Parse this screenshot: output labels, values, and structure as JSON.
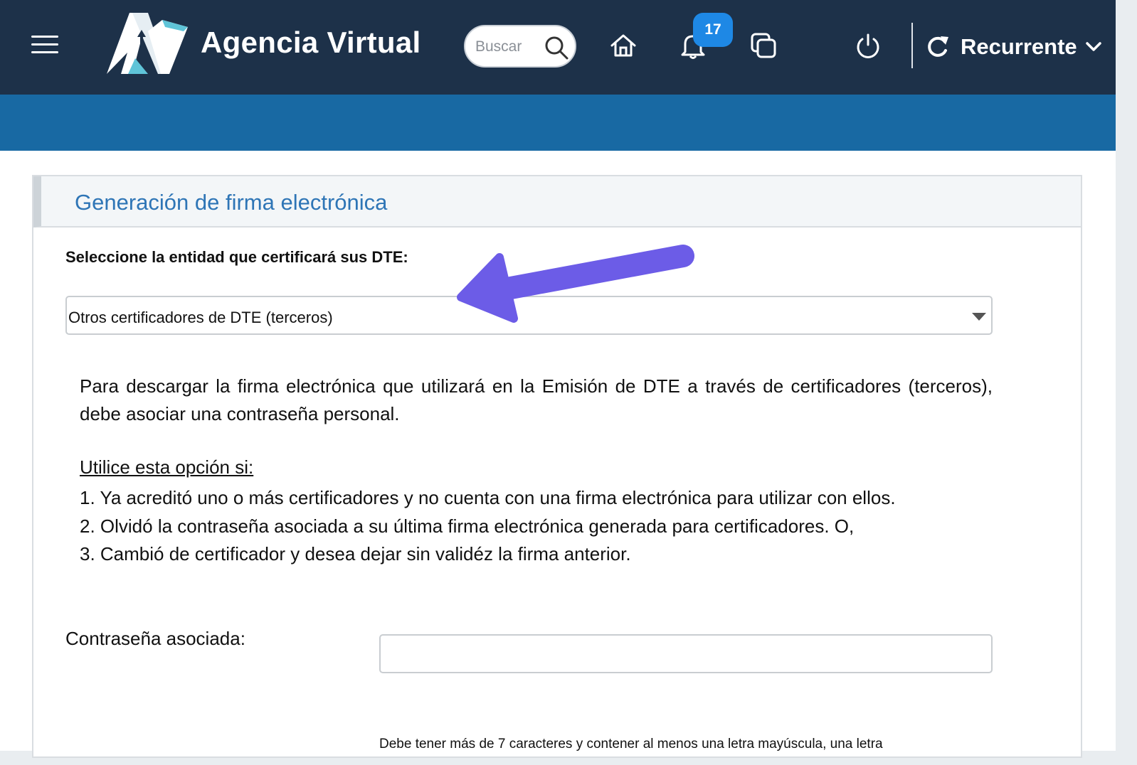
{
  "header": {
    "app_title": "Agencia Virtual",
    "search_placeholder": "Buscar",
    "notifications_count": "17",
    "profile_label": "Recurrente"
  },
  "card": {
    "title": "Generación de firma electrónica",
    "select_label": "Seleccione la entidad que certificará sus DTE:",
    "select_value": "Otros certificadores de DTE (terceros)",
    "intro_text": "Para descargar la firma electrónica que utilizará en la Emisión de DTE a través de certificadores (terceros), debe asociar una contraseña personal.",
    "use_heading": "Utilice esta opción si:",
    "use_items": [
      "1. Ya acreditó uno o más certificadores y no cuenta con una firma electrónica para utilizar con ellos.",
      "2. Olvidó la contraseña asociada a su última firma electrónica generada para certificadores. O,",
      "3. Cambió de certificador y desea dejar sin validéz la firma anterior."
    ],
    "password_label": "Contraseña asociada:",
    "password_value": "",
    "hint_text": "Debe tener más de 7 caracteres y contener al menos una letra mayúscula, una letra"
  },
  "colors": {
    "topbar": "#1d3149",
    "subbar": "#1869a3",
    "title_blue": "#2e75b6",
    "badge": "#1e88e5",
    "annotation_arrow": "#6c5ce7"
  },
  "icons": [
    "menu-icon",
    "agencia-virtual-logo",
    "search-icon",
    "home-icon",
    "bell-icon",
    "windows-icon",
    "power-icon",
    "sync-icon",
    "chevron-down-icon",
    "annotation-arrow"
  ]
}
